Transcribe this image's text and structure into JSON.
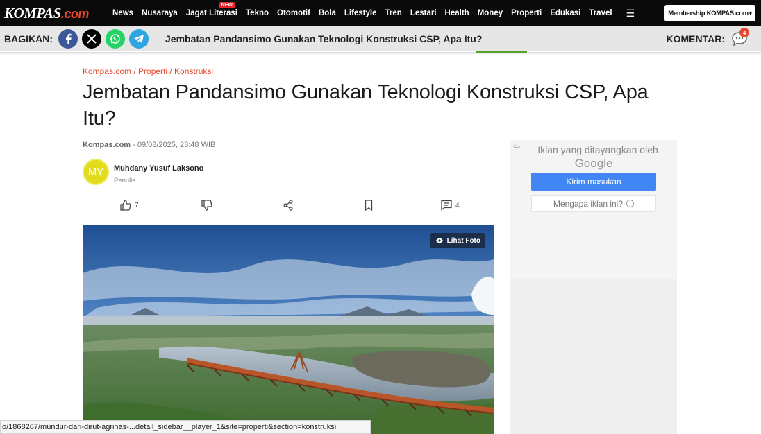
{
  "header": {
    "logo_main": "KOMPAS",
    "logo_suffix": ".com",
    "nav": [
      "News",
      "Nusaraya",
      "Jagat Literasi",
      "Tekno",
      "Otomotif",
      "Bola",
      "Lifestyle",
      "Tren",
      "Lestari",
      "Health",
      "Money",
      "Properti",
      "Edukasi",
      "Travel"
    ],
    "new_badge": "NEW",
    "membership_label": "Membership KOMPAS.com+"
  },
  "sharebar": {
    "label": "BAGIKAN:",
    "title": "Jembatan Pandansimo Gunakan Teknologi Konstruksi CSP, Apa Itu?",
    "komentar_label": "KOMENTAR:",
    "komentar_count": "4",
    "colors": {
      "facebook": "#3b5998",
      "x": "#000000",
      "whatsapp": "#25d366",
      "telegram": "#2ca5e0"
    }
  },
  "article": {
    "breadcrumb": "Kompas.com / Properti / Konstruksi",
    "title": "Jembatan Pandansimo Gunakan Teknologi Konstruksi CSP, Apa Itu?",
    "source": "Kompas.com",
    "datetime": " - 09/08/2025, 23:48 WIB",
    "author_initials": "MY",
    "author_name": "Muhdany Yusuf Laksono",
    "author_role": "Penulis",
    "likes": "7",
    "comments": "4",
    "photo_button": "Lihat Foto"
  },
  "ad": {
    "text": "Iklan yang ditayangkan oleh",
    "brand": "Google",
    "primary_button": "Kirim masukan",
    "secondary_button": "Mengapa iklan ini?"
  },
  "statusbar": {
    "url": "o/1868267/mundur-dari-dirut-agrinas-...detail_sidebar__player_1&site=properti&section=konstruksi"
  }
}
